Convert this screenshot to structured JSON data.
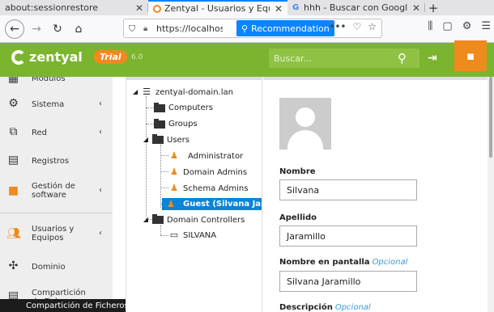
{
  "browser": {
    "tabs": [
      {
        "label": "about:sessionrestore"
      },
      {
        "label": "Zentyal - Usuarios y Equipos"
      },
      {
        "label": "hhh - Buscar con Google"
      }
    ],
    "url": "https://localhost",
    "recommendation": "Recommendation"
  },
  "header": {
    "logo": "zentyal",
    "trial": "Trial",
    "version": "6.0",
    "search_placeholder": "Buscar..."
  },
  "sidebar": {
    "items": [
      {
        "label": "Módulos"
      },
      {
        "label": "Sistema"
      },
      {
        "label": "Red"
      },
      {
        "label": "Registros"
      },
      {
        "label": "Gestión de software"
      },
      {
        "label": "Usuarios y Equipos"
      },
      {
        "label": "Dominio"
      },
      {
        "label": "Compartición de Ficheros"
      }
    ],
    "tooltip": "Compartición de Ficheros"
  },
  "tree": {
    "root": "zentyal-domain.lan",
    "computers": "Computers",
    "groups": "Groups",
    "users": "Users",
    "user_items": [
      "Administrator",
      "Domain Admins",
      "Schema Admins",
      "Guest (Silvana Jaramillo)"
    ],
    "dc": "Domain Controllers",
    "dc_items": [
      "SILVANA"
    ]
  },
  "form": {
    "nombre_label": "Nombre",
    "nombre_value": "Silvana",
    "apellido_label": "Apellido",
    "apellido_value": "Jaramillo",
    "pantalla_label": "Nombre en pantalla",
    "pantalla_opt": "Opcional",
    "pantalla_value": "Silvana Jaramillo",
    "desc_label": "Descripción",
    "desc_opt": "Opcional"
  }
}
